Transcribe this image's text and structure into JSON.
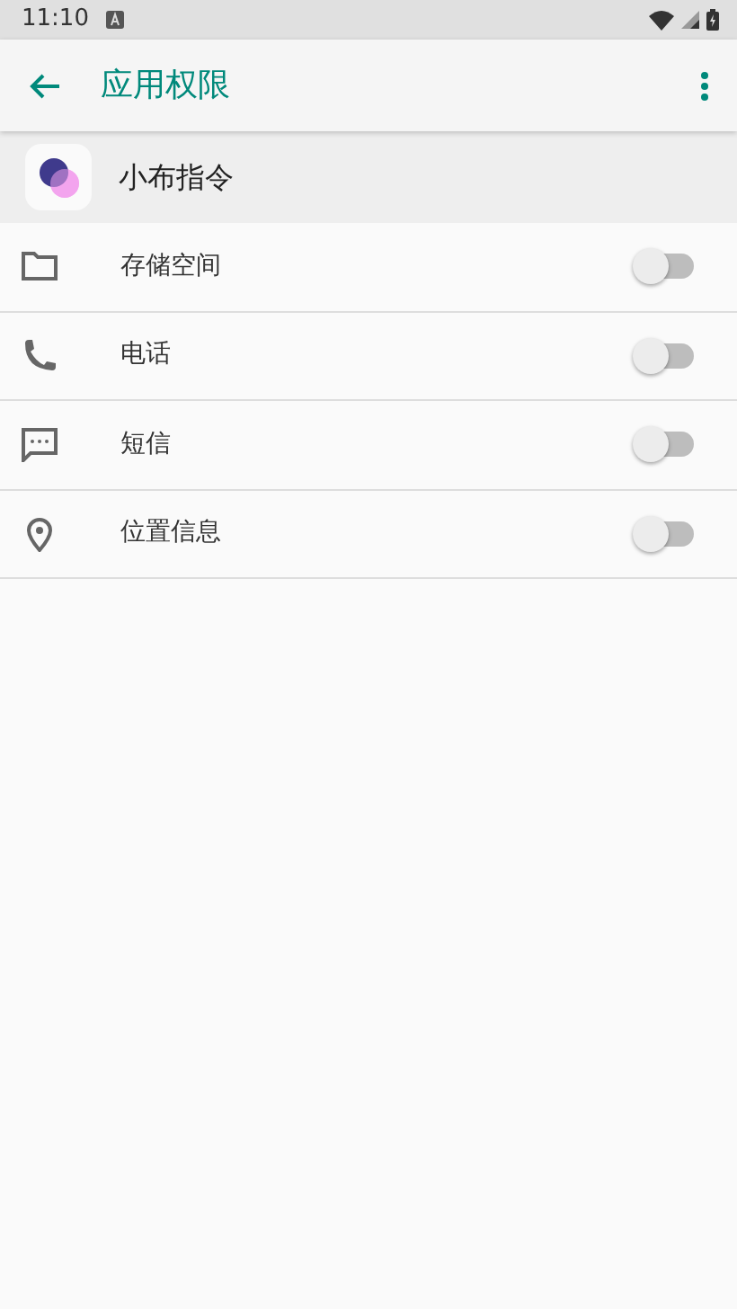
{
  "status_bar": {
    "time": "11:10"
  },
  "app_bar": {
    "title": "应用权限"
  },
  "app": {
    "name": "小布指令"
  },
  "permissions": [
    {
      "kind": "folder",
      "label": "存储空间",
      "on": false
    },
    {
      "kind": "phone",
      "label": "电话",
      "on": false
    },
    {
      "kind": "message",
      "label": "短信",
      "on": false
    },
    {
      "kind": "location",
      "label": "位置信息",
      "on": false
    }
  ]
}
